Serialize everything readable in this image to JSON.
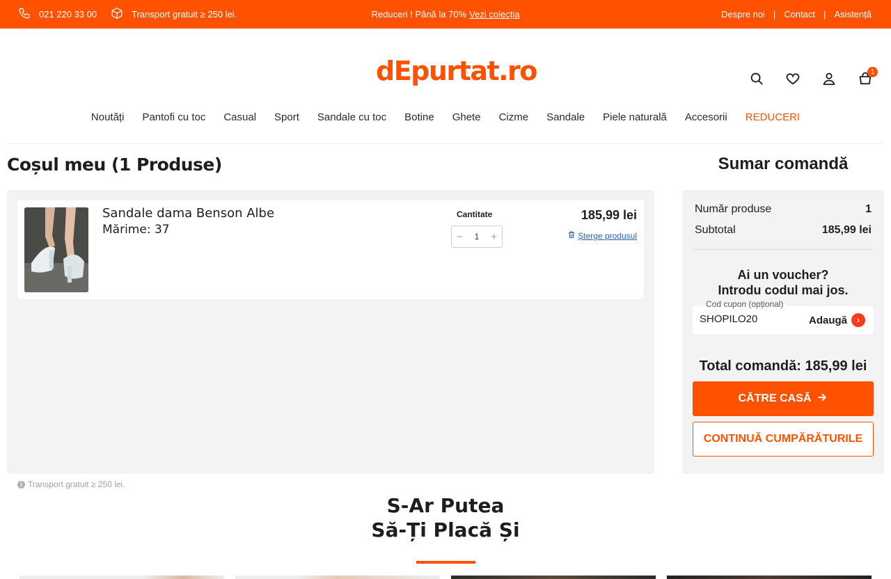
{
  "topbar": {
    "phone": "021 220 33 00",
    "shipping": "Transport gratuit ≥ 250 lei.",
    "promo_text": "Reduceri ! Până la 70%",
    "promo_link": "Vezi colecția",
    "links": [
      "Despre noi",
      "Contact",
      "Asistență"
    ],
    "colors": {
      "background": "#ff5200",
      "text": "#ffffff"
    }
  },
  "header": {
    "logo": "dEpurtat.ro",
    "cart_count": "1",
    "icons": [
      "search-icon",
      "heart-icon",
      "user-icon",
      "cart-icon"
    ]
  },
  "nav": {
    "items": [
      "Noutăți",
      "Pantofi cu toc",
      "Casual",
      "Sport",
      "Sandale cu toc",
      "Botine",
      "Ghete",
      "Cizme",
      "Sandale",
      "Piele naturală",
      "Accesorii"
    ],
    "sale": "REDUCERI"
  },
  "cart": {
    "title": "Coșul meu (1 Produse)",
    "items": [
      {
        "name": "Sandale dama Benson Albe",
        "size": "Mărime: 37",
        "quantity_label": "Cantitate",
        "quantity": "1",
        "price": "185,99 lei",
        "remove_label": "Șterge produsul"
      }
    ],
    "shipping_note": "Transport gratuit ≥ 250 lei."
  },
  "summary": {
    "title": "Sumar comandă",
    "products_label": "Număr produse",
    "products_value": "1",
    "subtotal_label": "Subtotal",
    "subtotal_value": "185,99 lei",
    "voucher_line1": "Ai un voucher?",
    "voucher_line2": "Introdu codul mai jos.",
    "coupon_label": "Cod cupon (opțional)",
    "coupon_value": "SHOPILO20",
    "coupon_add": "Adaugă",
    "total": "Total comandă: 185,99 lei",
    "checkout": "CĂTRE CASĂ",
    "continue": "CONTINUĂ CUMPĂRĂTURILE"
  },
  "suggestions": {
    "title_line1": "S-Ar Putea",
    "title_line2": "Să-Ți Placă Și"
  },
  "colors": {
    "accent": "#ff5200",
    "panel": "#f3f3f4",
    "link": "#2a5db0"
  }
}
